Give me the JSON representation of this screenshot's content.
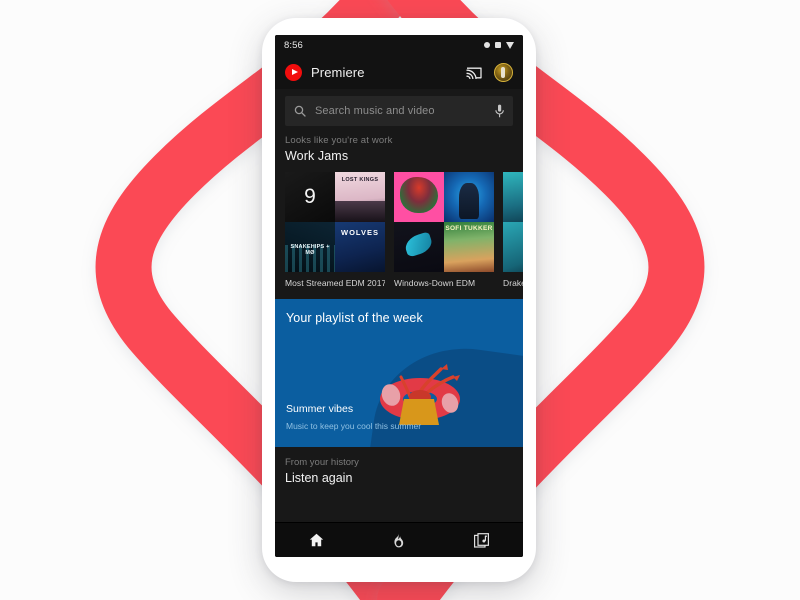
{
  "canvas": {
    "background_color": "#fcfcfc",
    "accent_color": "#fb4a55"
  },
  "phone": {
    "body_color": "#ffffff",
    "screen_background": "#181818"
  },
  "status_bar": {
    "time": "8:56",
    "icons": [
      "dot-icon",
      "square-icon",
      "signal-triangle-icon"
    ]
  },
  "app_bar": {
    "logo_icon": "premiere-play-logo-icon",
    "title": "Premiere",
    "cast_icon": "cast-icon",
    "avatar_icon": "account-avatar"
  },
  "search": {
    "search_icon": "search-icon",
    "placeholder": "Search music and video",
    "mic_icon": "microphone-icon"
  },
  "work_section": {
    "eyebrow": "Looks like you're at work",
    "title": "Work Jams",
    "cards": [
      {
        "label": "Most Streamed EDM 2017",
        "tiles": [
          {
            "kind": "count",
            "text": "9",
            "class": "a-nine"
          },
          {
            "kind": "art",
            "text": "LOST KINGS",
            "class": "a-lostkings"
          },
          {
            "kind": "art",
            "text": "SNAKEHIPS + MØ",
            "class": "a-snake"
          },
          {
            "kind": "art",
            "text": "WOLVES",
            "class": "a-wolves"
          }
        ]
      },
      {
        "label": "Windows-Down EDM",
        "tiles": [
          {
            "kind": "art",
            "text": "",
            "class": "a-pink"
          },
          {
            "kind": "art",
            "text": "",
            "class": "a-blue"
          },
          {
            "kind": "art",
            "text": "",
            "class": "a-dark"
          },
          {
            "kind": "art",
            "text": "SOFI TUKKER",
            "class": "a-sofi"
          }
        ]
      },
      {
        "label": "Drake F",
        "tiles": [
          {
            "kind": "art",
            "text": "",
            "class": "a-teal1"
          },
          {
            "kind": "art",
            "text": "",
            "class": "a-teal2"
          },
          {
            "kind": "art",
            "text": "",
            "class": "a-teal3"
          },
          {
            "kind": "art",
            "text": "",
            "class": "a-teal4"
          }
        ]
      }
    ]
  },
  "promo": {
    "title": "Your playlist of the week",
    "subtitle": "Summer vibes",
    "description": "Music to keep you cool this summer",
    "background_color": "#0b5ea0",
    "wave_color": "#0a4d86",
    "art_icon": "lobster-float-ring-illustration"
  },
  "history_section": {
    "eyebrow": "From your history",
    "title": "Listen again"
  },
  "bottom_nav": {
    "items": [
      {
        "icon": "home-icon",
        "label": "Home",
        "selected": true
      },
      {
        "icon": "flame-trending-icon",
        "label": "Trending",
        "selected": false
      },
      {
        "icon": "library-music-icon",
        "label": "Library",
        "selected": false
      }
    ]
  }
}
